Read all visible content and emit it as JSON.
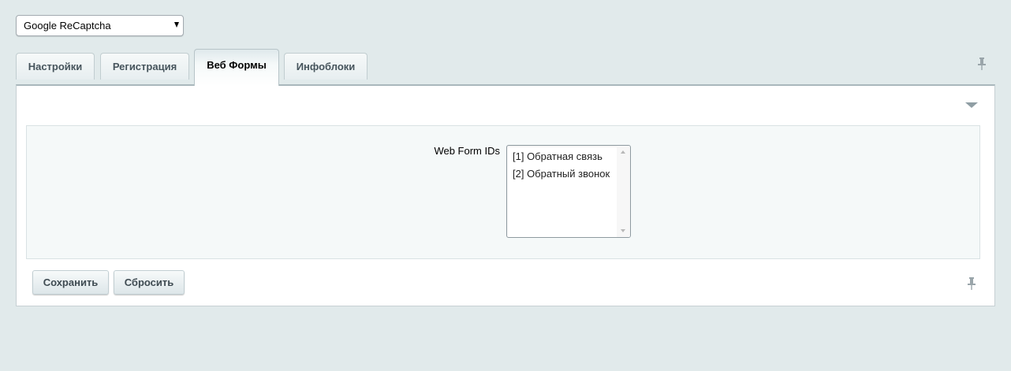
{
  "module_select": {
    "value": "Google ReCaptcha"
  },
  "tabs": [
    {
      "label": "Настройки"
    },
    {
      "label": "Регистрация"
    },
    {
      "label": "Веб Формы"
    },
    {
      "label": "Инфоблоки"
    }
  ],
  "active_tab": "Веб Формы",
  "form": {
    "web_form_ids_label": "Web Form IDs",
    "web_form_options": [
      {
        "label": "[1] Обратная связь"
      },
      {
        "label": "[2] Обратный звонок"
      }
    ]
  },
  "buttons": {
    "save_label": "Сохранить",
    "reset_label": "Сбросить"
  },
  "icons": {
    "collapse": "chevron-down-icon",
    "pin": "pin-icon",
    "dropdown": "caret-down-icon"
  },
  "colors": {
    "page_background": "#e1eaeb",
    "panel_background": "#ffffff",
    "inner_background": "#f5f9f9"
  }
}
